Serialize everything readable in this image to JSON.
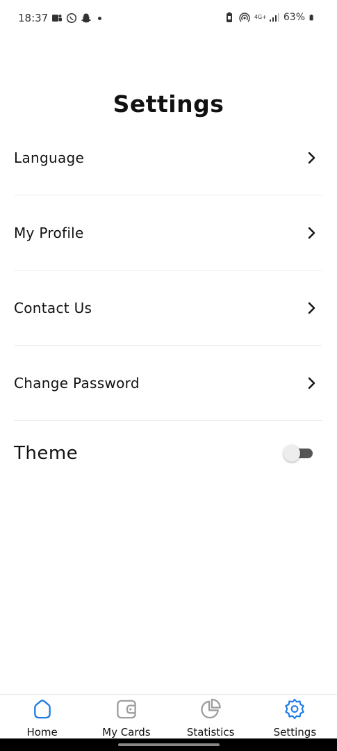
{
  "status_bar": {
    "time": "18:37",
    "network": "4G+",
    "battery": "63%"
  },
  "page": {
    "title": "Settings"
  },
  "settings": {
    "items": [
      {
        "label": "Language"
      },
      {
        "label": "My Profile"
      },
      {
        "label": "Contact Us"
      },
      {
        "label": "Change Password"
      }
    ],
    "theme": {
      "label": "Theme",
      "enabled": false
    }
  },
  "bottom_nav": {
    "items": [
      {
        "label": "Home",
        "icon": "home-icon",
        "active": true
      },
      {
        "label": "My Cards",
        "icon": "wallet-icon",
        "active": false
      },
      {
        "label": "Statistics",
        "icon": "pie-chart-icon",
        "active": false
      },
      {
        "label": "Settings",
        "icon": "gear-icon",
        "active": true
      }
    ]
  },
  "colors": {
    "accent": "#1e7be5",
    "inactive_icon": "#9e9e9e",
    "toggle_track": "#555555",
    "toggle_thumb": "#ededed"
  }
}
